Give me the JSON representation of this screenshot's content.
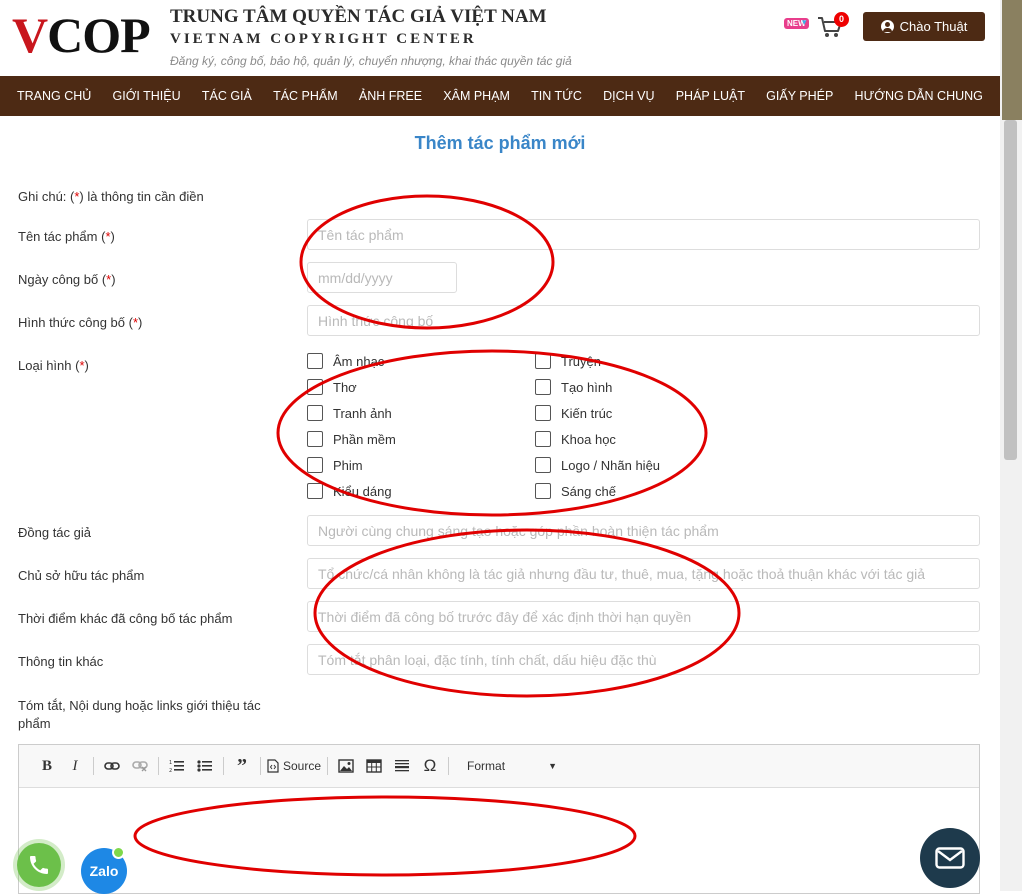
{
  "header": {
    "logo_v": "V",
    "logo_rest": "COP",
    "title": "TRUNG TÂM QUYỀN TÁC GIẢ VIỆT NAM",
    "subtitle": "VIETNAM COPYRIGHT CENTER",
    "slogan": "Đăng ký, công bố, bảo hộ, quản lý, chuyển nhượng, khai thác quyền tác giả",
    "new_badge": "NEW",
    "cart_count": "0",
    "user_label": "Chào Thuật"
  },
  "nav": {
    "items": [
      "TRANG CHỦ",
      "GIỚI THIỆU",
      "TÁC GIẢ",
      "TÁC PHẨM",
      "ẢNH FREE",
      "XÂM PHẠM",
      "TIN TỨC",
      "DỊCH VỤ",
      "PHÁP LUẬT",
      "GIẤY PHÉP",
      "HƯỚNG DẪN CHUNG"
    ]
  },
  "form": {
    "title": "Thêm tác phẩm mới",
    "note_prefix": "Ghi chú: (",
    "note_star": "*",
    "note_suffix": ") là thông tin cần điền",
    "req_star": "*",
    "fields": {
      "name": {
        "label": "Tên tác phẩm (",
        "placeholder": "Tên tác phẩm"
      },
      "date": {
        "label": "Ngày công bố (",
        "placeholder": "mm/dd/yyyy"
      },
      "form_type": {
        "label": "Hình thức công bố (",
        "placeholder": "Hình thức công bố"
      },
      "category": {
        "label": "Loại hình ("
      },
      "coauthor": {
        "label": "Đồng tác giả",
        "placeholder": "Người cùng chung sáng tạo hoặc góp phần hoàn thiện tác phẩm"
      },
      "owner": {
        "label": "Chủ sở hữu tác phẩm",
        "placeholder": "Tổ chức/cá nhân không là tác giả nhưng đầu tư, thuê, mua, tặng hoặc thoả thuận khác với tác giả"
      },
      "other_time": {
        "label": "Thời điểm khác đã công bố tác phẩm",
        "placeholder": "Thời điểm đã công bố trước đây để xác định thời hạn quyền"
      },
      "other_info": {
        "label": "Thông tin khác",
        "placeholder": "Tóm tắt phân loại, đặc tính, tính chất, dấu hiệu đặc thù"
      },
      "summary": {
        "label": "Tóm tắt, Nội dung hoặc links giới thiệu tác phẩm"
      }
    },
    "categories_left": [
      "Âm nhạc",
      "Thơ",
      "Tranh ảnh",
      "Phần mềm",
      "Phim",
      "Kiểu dáng"
    ],
    "categories_right": [
      "Truyện",
      "Tạo hình",
      "Kiến trúc",
      "Khoa học",
      "Logo / Nhãn hiệu",
      "Sáng chế"
    ]
  },
  "editor": {
    "source_label": "Source",
    "format_label": "Format"
  },
  "floating": {
    "zalo_label": "Zalo"
  },
  "colors": {
    "brand_brown": "#4d2a14",
    "title_blue": "#3a86c8",
    "required_red": "#dd0000",
    "annotation_red": "#e00000"
  }
}
